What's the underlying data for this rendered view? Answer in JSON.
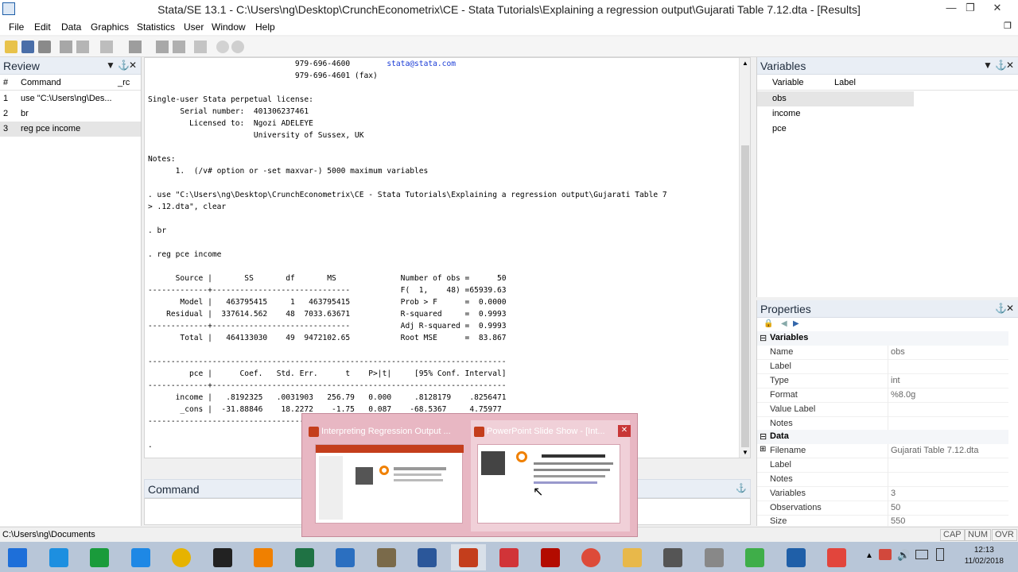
{
  "window": {
    "title": "Stata/SE 13.1 - C:\\Users\\ng\\Desktop\\CrunchEconometrix\\CE - Stata Tutorials\\Explaining a regression output\\Gujarati Table 7.12.dta - [Results]"
  },
  "menu": [
    "File",
    "Edit",
    "Data",
    "Graphics",
    "Statistics",
    "User",
    "Window",
    "Help"
  ],
  "review": {
    "title": "Review",
    "columns": [
      "#",
      "Command",
      "_rc"
    ],
    "rows": [
      {
        "n": "1",
        "cmd": "use \"C:\\Users\\ng\\Des..."
      },
      {
        "n": "2",
        "cmd": "br"
      },
      {
        "n": "3",
        "cmd": "reg pce income"
      }
    ]
  },
  "results": {
    "lines": [
      "                                979-696-4600        stata@stata.com",
      "                                979-696-4601 (fax)",
      "",
      "Single-user Stata perpetual license:",
      "       Serial number:  401306237461",
      "         Licensed to:  Ngozi ADELEYE",
      "                       University of Sussex, UK",
      "",
      "Notes:",
      "      1.  (/v# option or -set maxvar-) 5000 maximum variables",
      "",
      ". use \"C:\\Users\\ng\\Desktop\\CrunchEconometrix\\CE - Stata Tutorials\\Explaining a regression output\\Gujarati Table 7",
      "> .12.dta\", clear",
      "",
      ". br",
      "",
      ". reg pce income",
      "",
      "      Source |       SS       df       MS              Number of obs =      50",
      "-------------+------------------------------           F(  1,    48) =65939.63",
      "       Model |   463795415     1   463795415           Prob > F      =  0.0000",
      "    Residual |  337614.562    48  7033.63671           R-squared     =  0.9993",
      "-------------+------------------------------           Adj R-squared =  0.9993",
      "       Total |   464133030    49  9472102.65           Root MSE      =  83.867",
      "",
      "------------------------------------------------------------------------------",
      "         pce |      Coef.   Std. Err.      t    P>|t|     [95% Conf. Interval]",
      "-------------+----------------------------------------------------------------",
      "      income |   .8192325   .0031903   256.79   0.000     .8128179    .8256471",
      "       _cons |  -31.88846    18.2272    -1.75   0.087    -68.5367     4.75977",
      "------------------------------------------------------------------------------",
      "",
      "."
    ]
  },
  "command": {
    "title": "Command"
  },
  "variables": {
    "title": "Variables",
    "columns": [
      "Variable",
      "Label"
    ],
    "rows": [
      "obs",
      "income",
      "pce"
    ]
  },
  "properties": {
    "title": "Properties",
    "sections": [
      {
        "name": "Variables",
        "rows": [
          {
            "k": "Name",
            "v": "obs"
          },
          {
            "k": "Label",
            "v": ""
          },
          {
            "k": "Type",
            "v": "int"
          },
          {
            "k": "Format",
            "v": "%8.0g"
          },
          {
            "k": "Value Label",
            "v": ""
          },
          {
            "k": "Notes",
            "v": ""
          }
        ]
      },
      {
        "name": "Data",
        "rows": [
          {
            "k": "Filename",
            "v": "Gujarati Table 7.12.dta"
          },
          {
            "k": "Label",
            "v": ""
          },
          {
            "k": "Notes",
            "v": ""
          },
          {
            "k": "Variables",
            "v": "3"
          },
          {
            "k": "Observations",
            "v": "50"
          },
          {
            "k": "Size",
            "v": "550"
          }
        ]
      }
    ]
  },
  "status": {
    "path": "C:\\Users\\ng\\Documents",
    "indicators": [
      "CAP",
      "NUM",
      "OVR"
    ]
  },
  "popup": {
    "cards": [
      {
        "title": "Interpreting Regression Output ..."
      },
      {
        "title": "PowerPoint Slide Show - [Int..."
      }
    ]
  },
  "taskbar": {
    "apps": [
      {
        "name": "start",
        "color": "#1e6fd9"
      },
      {
        "name": "internet-explorer",
        "color": "#1d8fe0"
      },
      {
        "name": "store",
        "color": "#1a9b3b"
      },
      {
        "name": "app-feather",
        "color": "#1e88e5"
      },
      {
        "name": "media-player",
        "color": "#e6b300"
      },
      {
        "name": "hp",
        "color": "#222222"
      },
      {
        "name": "vlc",
        "color": "#f08000"
      },
      {
        "name": "excel",
        "color": "#1f7244"
      },
      {
        "name": "calculator",
        "color": "#2b6fc0"
      },
      {
        "name": "en-books",
        "color": "#7a6a4a"
      },
      {
        "name": "word",
        "color": "#2b579a"
      },
      {
        "name": "powerpoint",
        "color": "#c43e1c"
      },
      {
        "name": "app-red",
        "color": "#d13438"
      },
      {
        "name": "acrobat",
        "color": "#b30b00"
      },
      {
        "name": "chrome",
        "color": "#dd4b39"
      },
      {
        "name": "file-explorer",
        "color": "#e8b84a"
      },
      {
        "name": "tool-pen",
        "color": "#555555"
      },
      {
        "name": "tool-satellite",
        "color": "#888888"
      },
      {
        "name": "camtasia",
        "color": "#3fae49"
      },
      {
        "name": "stata",
        "color": "#1f5fa8"
      },
      {
        "name": "screencast",
        "color": "#e2453c"
      }
    ],
    "time": "12:13",
    "date": "11/02/2018"
  }
}
